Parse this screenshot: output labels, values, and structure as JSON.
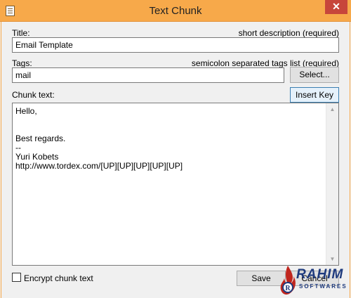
{
  "window": {
    "title": "Text Chunk",
    "close_glyph": "✕"
  },
  "title_field": {
    "label": "Title:",
    "hint": "short description (required)",
    "value": "Email Template"
  },
  "tags_field": {
    "label": "Tags:",
    "hint": "semicolon separated tags list (required)",
    "value": "mail",
    "select_button": "Select..."
  },
  "chunk": {
    "label": "Chunk text:",
    "insert_key_button": "Insert Key",
    "text": "Hello,\n\n\nBest regards.\n--\nYuri Kobets\nhttp://www.tordex.com/[UP][UP][UP][UP][UP]"
  },
  "footer": {
    "encrypt_label": "Encrypt chunk text",
    "encrypt_checked": false,
    "save_button": "Save",
    "cancel_button": "Cancel"
  },
  "watermark": {
    "name": "RAHIM",
    "sub": "SOFTWARES"
  },
  "colors": {
    "titlebar": "#f7a94a",
    "close_button": "#c7463b",
    "logo_blue": "#1e3a7d",
    "logo_red": "#c0261e"
  }
}
